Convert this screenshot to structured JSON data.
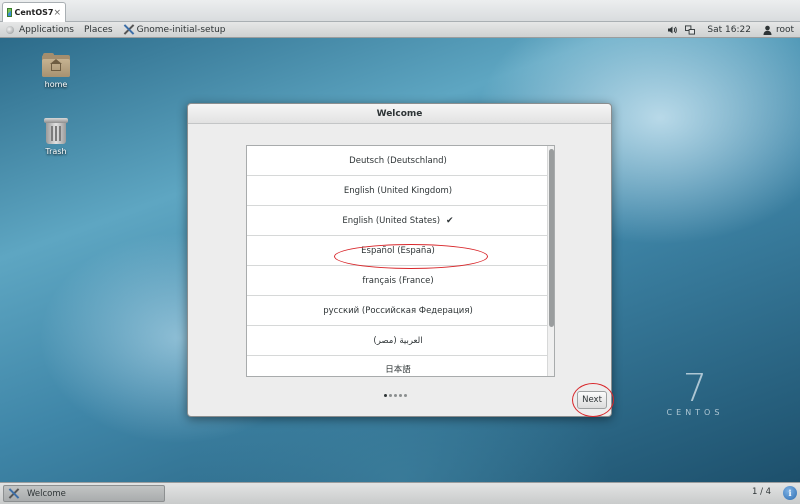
{
  "vm_tab": {
    "title": "CentOS7",
    "close_glyph": "×",
    "icon": "vm-icon"
  },
  "top_bar": {
    "applications": "Applications",
    "places": "Places",
    "app_name": "Gnome-initial-setup",
    "clock": "Sat 16:22",
    "user": "root",
    "icons": [
      "volume-icon",
      "network-icon",
      "user-icon"
    ]
  },
  "desktop": {
    "icons": [
      {
        "label": "home",
        "icon": "home-folder-icon"
      },
      {
        "label": "Trash",
        "icon": "trash-icon"
      }
    ],
    "watermark": {
      "number": "7",
      "word": "CENTOS"
    }
  },
  "dialog": {
    "title": "Welcome",
    "languages": [
      {
        "label": "Deutsch (Deutschland)",
        "selected": false
      },
      {
        "label": "English (United Kingdom)",
        "selected": false
      },
      {
        "label": "English (United States)",
        "selected": true
      },
      {
        "label": "Español (España)",
        "selected": false
      },
      {
        "label": "français (France)",
        "selected": false
      },
      {
        "label": "русский (Российская Федерация)",
        "selected": false
      },
      {
        "label": "العربية (مصر)",
        "selected": false
      },
      {
        "label": "日本語",
        "selected": false
      }
    ],
    "check_glyph": "✔",
    "pager": {
      "pages": 5,
      "current": 1
    },
    "next_label": "Next"
  },
  "taskbar": {
    "window_label": "Welcome",
    "workspace": "1 / 4",
    "notify_glyph": "i"
  },
  "colors": {
    "annotation": "#d8262a",
    "selected_check": "#2e3436"
  }
}
